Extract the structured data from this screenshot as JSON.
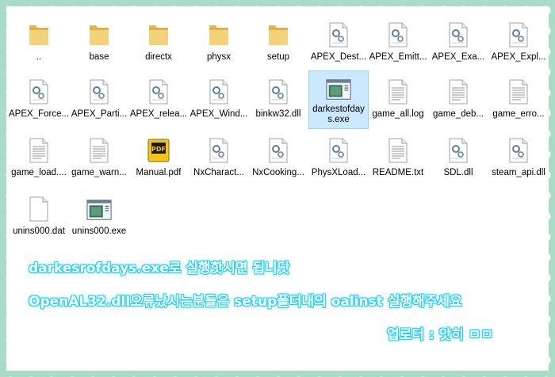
{
  "files": [
    {
      "label": "..",
      "icon": "folder-icon"
    },
    {
      "label": "base",
      "icon": "folder-icon"
    },
    {
      "label": "directx",
      "icon": "folder-icon"
    },
    {
      "label": "physx",
      "icon": "folder-icon"
    },
    {
      "label": "setup",
      "icon": "folder-icon"
    },
    {
      "label": "APEX_Dest...",
      "icon": "dll-file-icon"
    },
    {
      "label": "APEX_Emitt...",
      "icon": "dll-file-icon"
    },
    {
      "label": "APEX_Exa...",
      "icon": "dll-file-icon"
    },
    {
      "label": "APEX_Expl...",
      "icon": "dll-file-icon"
    },
    {
      "label": "APEX_Force...",
      "icon": "dll-file-icon"
    },
    {
      "label": "APEX_Parti...",
      "icon": "dll-file-icon"
    },
    {
      "label": "APEX_relea...",
      "icon": "dll-file-icon"
    },
    {
      "label": "APEX_Wind...",
      "icon": "dll-file-icon"
    },
    {
      "label": "binkw32.dll",
      "icon": "dll-file-icon"
    },
    {
      "label": "darkestofdays.exe",
      "icon": "exe-app-icon",
      "selected": true
    },
    {
      "label": "game_all.log",
      "icon": "text-file-icon"
    },
    {
      "label": "game_deb...",
      "icon": "text-file-icon"
    },
    {
      "label": "game_erro...",
      "icon": "text-file-icon"
    },
    {
      "label": "game_load....",
      "icon": "text-file-icon"
    },
    {
      "label": "game_warn...",
      "icon": "text-file-icon"
    },
    {
      "label": "Manual.pdf",
      "icon": "pdf-file-icon"
    },
    {
      "label": "NxCharact...",
      "icon": "dll-file-icon"
    },
    {
      "label": "NxCooking...",
      "icon": "dll-file-icon"
    },
    {
      "label": "PhysXLoad...",
      "icon": "dll-file-icon"
    },
    {
      "label": "README.txt",
      "icon": "text-file-icon"
    },
    {
      "label": "SDL.dll",
      "icon": "dll-file-icon"
    },
    {
      "label": "steam_api.dll",
      "icon": "dll-file-icon"
    },
    {
      "label": "unins000.dat",
      "icon": "blank-file-icon"
    },
    {
      "label": "unins000.exe",
      "icon": "exe-app-icon"
    }
  ],
  "notes": {
    "line1": "darkesrofdays.exe로 실행핫시면 됩니닷",
    "line2": "OpenAL32.dll오류났시는분들은 setup폴더내의 oalinst 실행해주세요",
    "line3": "업로더 : 앗히 ㅁㅁ"
  },
  "colors": {
    "background": "#a8dcc9",
    "selection": "#cce8ff",
    "note_glow": "#19d0ff"
  }
}
